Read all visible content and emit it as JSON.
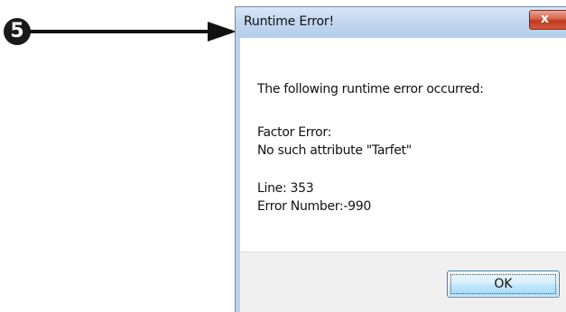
{
  "callout": {
    "number": "5"
  },
  "dialog": {
    "title": "Runtime Error!",
    "close_label": "x",
    "message_intro": "The following runtime error occurred:",
    "error_type": "Factor Error:",
    "error_detail": "No such attribute \"Tarfet\"",
    "line": "Line: 353",
    "error_number": "Error Number:-990",
    "ok_label": "OK"
  },
  "colors": {
    "titlebar": "#c3d8f1",
    "close_button": "#c0391f",
    "ok_button_border": "#3c7fb1",
    "footer": "#f0f0f0"
  },
  "icons": {
    "arrow": "arrow-right-icon",
    "close": "close-icon"
  }
}
